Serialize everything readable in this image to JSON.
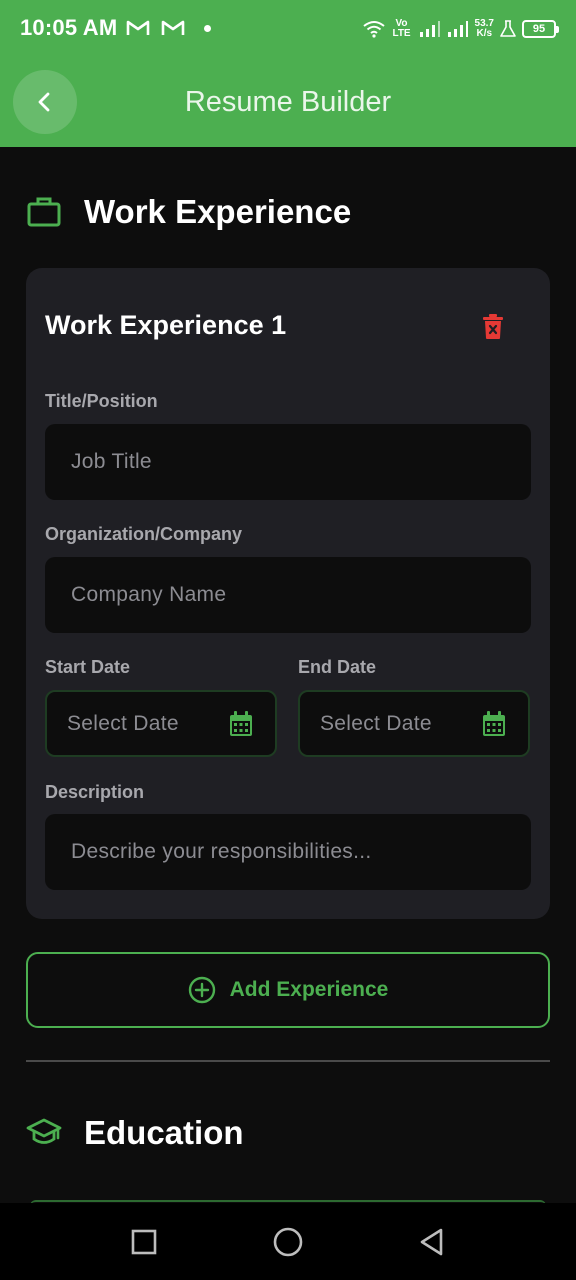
{
  "status_bar": {
    "time": "10:05 AM",
    "network_type": "Vo LTE",
    "speed_value": "53.7",
    "speed_unit": "K/s",
    "battery": "95",
    "icons": [
      "gmail-icon",
      "gmail-icon",
      "notification-dot",
      "wifi-icon",
      "signal-icon",
      "signal-icon",
      "lab-icon",
      "battery-icon"
    ]
  },
  "app_bar": {
    "title": "Resume Builder",
    "back_icon": "chevron-left-icon"
  },
  "work_section": {
    "title": "Work Experience",
    "icon": "briefcase-icon",
    "entries": [
      {
        "title": "Work Experience 1",
        "delete_icon": "trash-icon",
        "fields": {
          "title_label": "Title/Position",
          "title_placeholder": "Job Title",
          "org_label": "Organization/Company",
          "org_placeholder": "Company Name",
          "start_label": "Start Date",
          "start_placeholder": "Select Date",
          "end_label": "End Date",
          "end_placeholder": "Select Date",
          "desc_label": "Description",
          "desc_placeholder": "Describe your responsibilities..."
        }
      }
    ],
    "add_button_label": "Add Experience"
  },
  "education_section": {
    "title": "Education",
    "icon": "graduation-cap-icon"
  },
  "nav_bar": {
    "buttons": [
      "recents-square-icon",
      "home-circle-icon",
      "back-triangle-icon"
    ]
  },
  "colors": {
    "accent": "#4caf50",
    "background": "#0d0d0d",
    "card": "#1f1f24",
    "danger": "#e53935"
  }
}
